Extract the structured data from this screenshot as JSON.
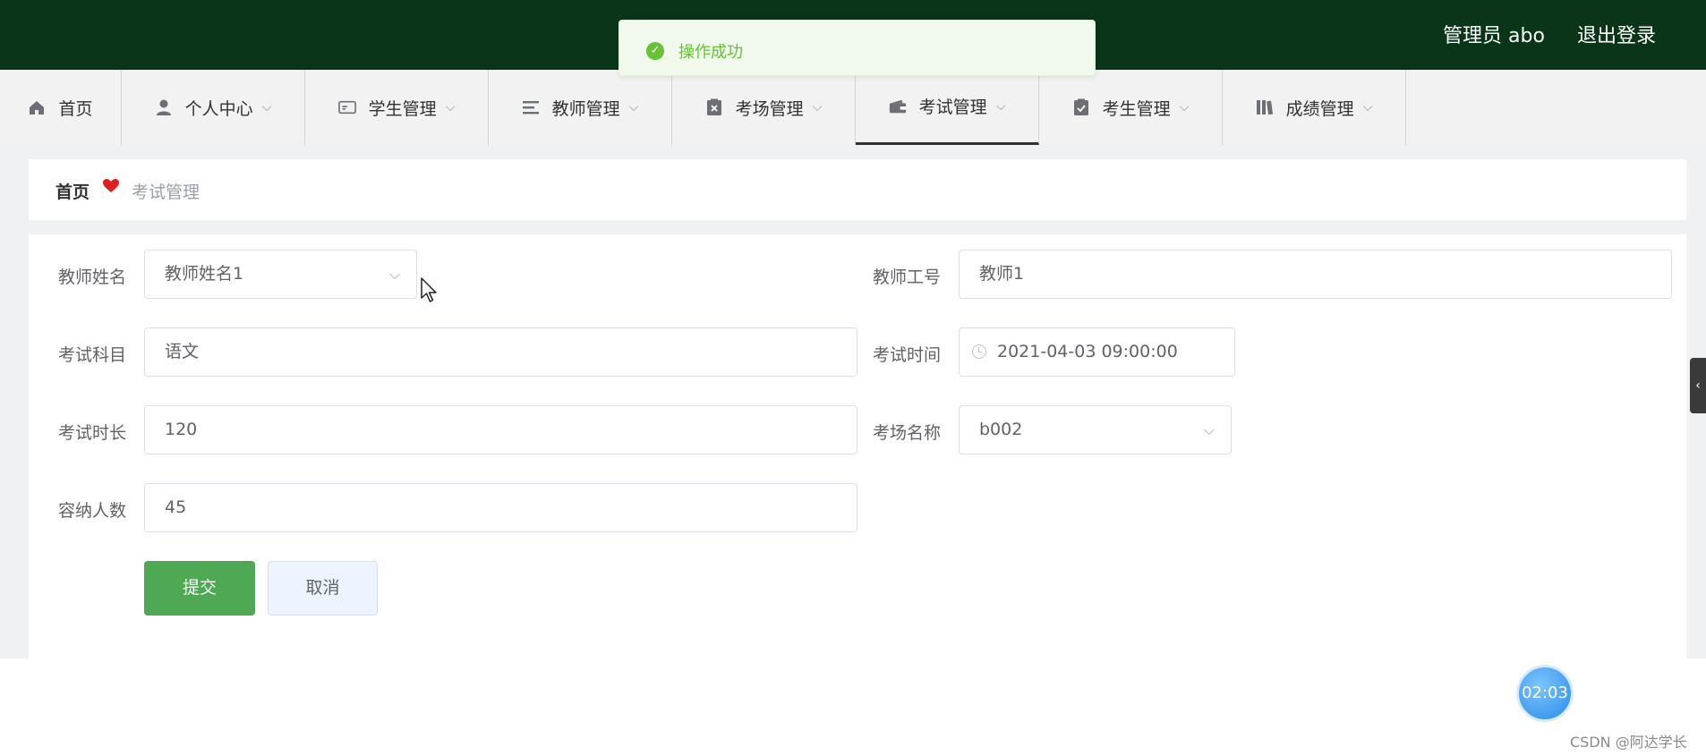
{
  "header": {
    "user_label": "管理员 abo",
    "logout_label": "退出登录",
    "background_color": "#0a3518"
  },
  "toast": {
    "message": "操作成功",
    "icon": "check-circle-icon",
    "color": "#67c23a"
  },
  "nav": {
    "items": [
      {
        "label": "首页",
        "icon": "home-icon",
        "has_dropdown": false
      },
      {
        "label": "个人中心",
        "icon": "user-icon",
        "has_dropdown": true
      },
      {
        "label": "学生管理",
        "icon": "id-card-icon",
        "has_dropdown": true
      },
      {
        "label": "教师管理",
        "icon": "list-icon",
        "has_dropdown": true
      },
      {
        "label": "考场管理",
        "icon": "clipboard-x-icon",
        "has_dropdown": true
      },
      {
        "label": "考试管理",
        "icon": "wallet-icon",
        "has_dropdown": true,
        "active": true
      },
      {
        "label": "考生管理",
        "icon": "clipboard-check-icon",
        "has_dropdown": true
      },
      {
        "label": "成绩管理",
        "icon": "books-icon",
        "has_dropdown": true
      }
    ]
  },
  "breadcrumb": {
    "home": "首页",
    "current": "考试管理"
  },
  "form": {
    "teacher_name": {
      "label": "教师姓名",
      "value": "教师姓名1"
    },
    "teacher_id": {
      "label": "教师工号",
      "value": "教师1"
    },
    "subject": {
      "label": "考试科目",
      "value": "语文"
    },
    "exam_time": {
      "label": "考试时间",
      "value": "2021-04-03 09:00:00"
    },
    "duration": {
      "label": "考试时长",
      "value": "120"
    },
    "room_name": {
      "label": "考场名称",
      "value": "b002"
    },
    "capacity": {
      "label": "容纳人数",
      "value": "45"
    },
    "submit_label": "提交",
    "cancel_label": "取消"
  },
  "overlay": {
    "timer": "02:03",
    "watermark": "CSDN @阿达学长"
  }
}
